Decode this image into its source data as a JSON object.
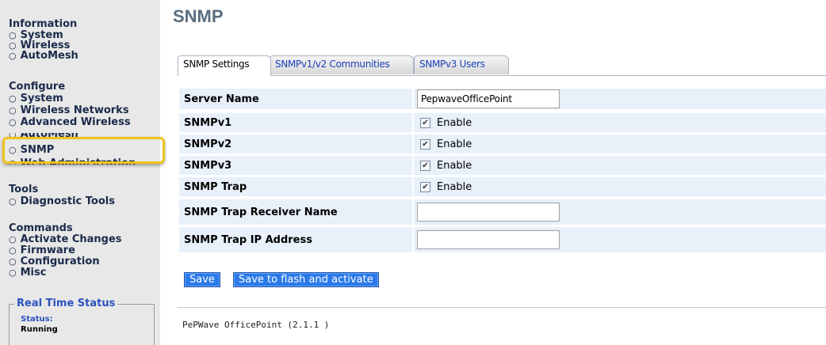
{
  "sidebar": {
    "information": {
      "title": "Information",
      "items": [
        "System",
        "Wireless",
        "AutoMesh"
      ]
    },
    "configure": {
      "title": "Configure",
      "items": [
        "System",
        "Wireless Networks",
        "Advanced Wireless",
        "AutoMesh",
        "SNMP",
        "Web Administration"
      ],
      "selected": "SNMP"
    },
    "tools": {
      "title": "Tools",
      "items": [
        "Diagnostic Tools"
      ]
    },
    "commands": {
      "title": "Commands",
      "items": [
        "Activate Changes",
        "Firmware",
        "Configuration",
        "Misc"
      ]
    },
    "realtime": {
      "title": "Real Time Status",
      "status_label": "Status:",
      "status_value": "Running"
    }
  },
  "main": {
    "title": "SNMP",
    "tabs": [
      {
        "label": "SNMP Settings",
        "active": true
      },
      {
        "label": "SNMPv1/v2 Communities",
        "active": false
      },
      {
        "label": "SNMPv3 Users",
        "active": false
      }
    ],
    "form": {
      "server_name": {
        "label": "Server Name",
        "value": "PepwaveOfficePoint"
      },
      "snmpv1": {
        "label": "SNMPv1",
        "checkbox_label": "Enable",
        "checked": true
      },
      "snmpv2": {
        "label": "SNMPv2",
        "checkbox_label": "Enable",
        "checked": true
      },
      "snmpv3": {
        "label": "SNMPv3",
        "checkbox_label": "Enable",
        "checked": true
      },
      "snmp_trap": {
        "label": "SNMP Trap",
        "checkbox_label": "Enable",
        "checked": true
      },
      "trap_receiver_name": {
        "label": "SNMP Trap Receiver Name",
        "value": ""
      },
      "trap_ip_address": {
        "label": "SNMP Trap IP Address",
        "value": ""
      }
    },
    "buttons": {
      "save": "Save",
      "save_flash": "Save to flash and activate"
    },
    "footer": "PePWave OfficePoint (2.1.1 )"
  },
  "colors": {
    "sidebar_bg": "#e8e8e8",
    "highlight": "#f0c419",
    "button_blue": "#2a7ae8",
    "row_bg": "#e8f0fa",
    "title_gray": "#5a6e80"
  }
}
